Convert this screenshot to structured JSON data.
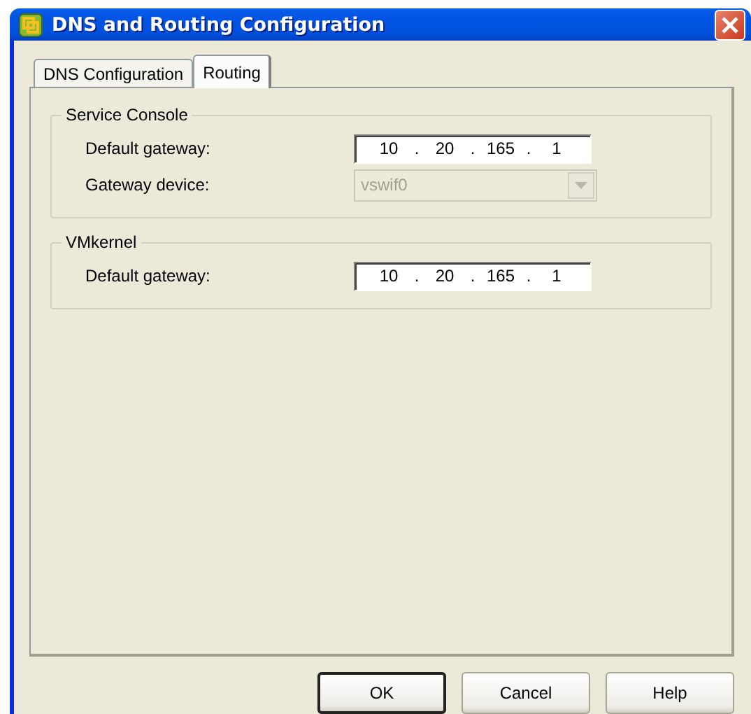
{
  "window": {
    "title": "DNS and Routing Configuration"
  },
  "tabs": [
    {
      "label": "DNS Configuration",
      "selected": false
    },
    {
      "label": "Routing",
      "selected": true
    }
  ],
  "groups": [
    {
      "title": "Service Console",
      "fields": [
        {
          "kind": "ip",
          "label": "Default gateway:",
          "octets": [
            "10",
            "20",
            "165",
            "1"
          ],
          "separator": "."
        },
        {
          "kind": "dropdown",
          "label": "Gateway device:",
          "value": "vswif0",
          "disabled": true
        }
      ]
    },
    {
      "title": "VMkernel",
      "fields": [
        {
          "kind": "ip",
          "label": "Default gateway:",
          "octets": [
            "10",
            "20",
            "165",
            "1"
          ],
          "separator": "."
        }
      ]
    }
  ],
  "buttons": [
    {
      "label": "OK",
      "default": true
    },
    {
      "label": "Cancel",
      "default": false
    },
    {
      "label": "Help",
      "default": false
    }
  ]
}
